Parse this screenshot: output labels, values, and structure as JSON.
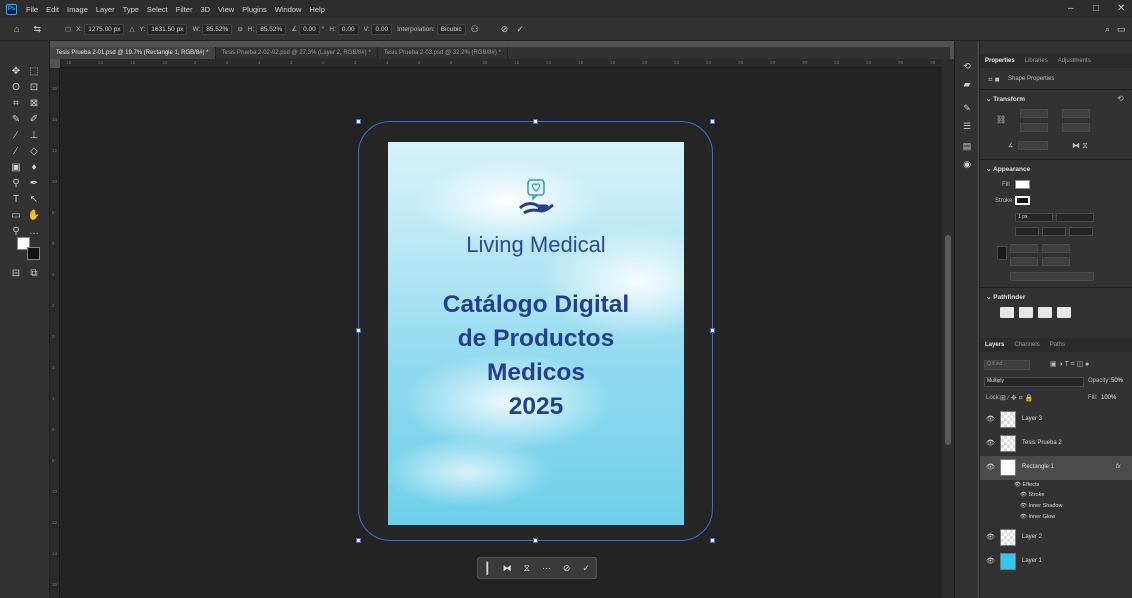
{
  "menu": {
    "app_icon": "Ps",
    "items": [
      "File",
      "Edit",
      "Image",
      "Layer",
      "Type",
      "Select",
      "Filter",
      "3D",
      "View",
      "Plugins",
      "Window",
      "Help"
    ],
    "window_controls": [
      "–",
      "□",
      "✕"
    ]
  },
  "options_bar": {
    "x_label": "X:",
    "x_value": "1275.00 px",
    "y_label": "Y:",
    "y_value": "1631.50 px",
    "w_label": "W:",
    "w_value": "85.52%",
    "h_label": "H:",
    "h_value": "85.52%",
    "angle_value": "0.00",
    "hskew_label": "H:",
    "hskew_value": "0.00",
    "vskew_label": "V:",
    "vskew_value": "0.00",
    "interpolation_label": "Interpolation:",
    "interpolation_value": "Bicubic"
  },
  "tabs": [
    {
      "label": "Tesis Prueba 2-01.psd @ 19.7% (Rectangle 1, RGB/8#) *",
      "active": true
    },
    {
      "label": "Tesis Prueba 2-02-02.psd @ 27.3% (Layer 2, RGB/8#) *",
      "active": false
    },
    {
      "label": "Tesis Prueba 2-03.psd @ 32.2% (RGB/8#) *",
      "active": false
    }
  ],
  "document": {
    "brand": "Living Medical",
    "catalog_lines": [
      "Catálogo Digital",
      "de Productos",
      "Medicos",
      "2025"
    ],
    "brand_color": "#2c4a92"
  },
  "properties_panel": {
    "tabs": [
      "Properties",
      "Libraries",
      "Adjustments"
    ],
    "kind": "Shape Properties",
    "transform_title": "Transform",
    "appearance_title": "Appearance",
    "fill_label": "Fill",
    "stroke_label": "Stroke",
    "stroke_width": "1 px",
    "pathfinder_title": "Pathfinder"
  },
  "layers_panel": {
    "tabs": [
      "Layers",
      "Channels",
      "Paths"
    ],
    "search_placeholder": "Q Kind",
    "blend_mode": "Multiply",
    "opacity_label": "Opacity:",
    "opacity_value": "50%",
    "lock_label": "Lock:",
    "fill_label": "Fill:",
    "fill_value": "100%",
    "layers": [
      {
        "name": "Layer 3",
        "selected": false
      },
      {
        "name": "Tesis Prueba 2",
        "selected": false
      },
      {
        "name": "Rectangle 1",
        "selected": true,
        "fx": "fx"
      },
      {
        "name": "Layer 2",
        "selected": false
      },
      {
        "name": "Layer 1",
        "selected": false
      }
    ],
    "effects_title": "Effects",
    "effects": [
      "Stroke",
      "Inner Shadow",
      "Inner Glow"
    ]
  },
  "ruler_labels": [
    "16",
    "14",
    "12",
    "10",
    "8",
    "6",
    "4",
    "2",
    "0",
    "2",
    "4",
    "6",
    "8",
    "10",
    "12",
    "14",
    "16",
    "18",
    "20",
    "22",
    "24",
    "26",
    "28",
    "30",
    "32",
    "34",
    "36",
    "38"
  ],
  "colors": {
    "accent": "#31a8ff",
    "selection": "#3b6fd6",
    "layer1_thumb": "#2ec8f0"
  }
}
